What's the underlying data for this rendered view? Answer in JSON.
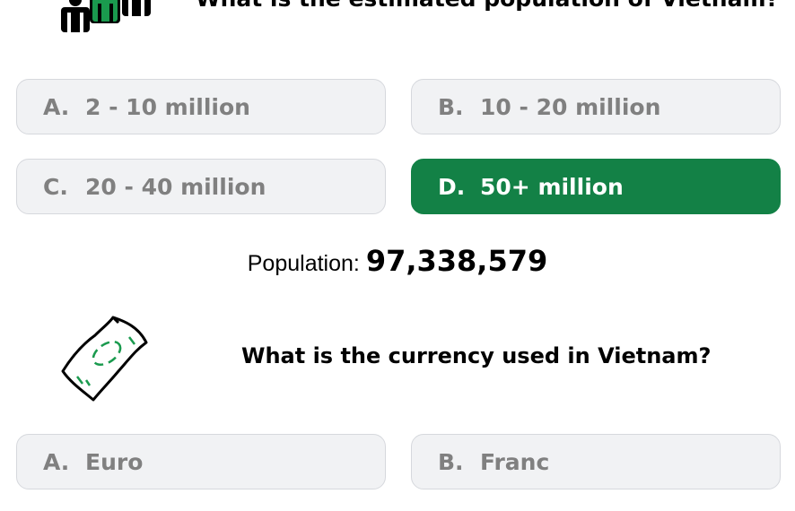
{
  "question1": {
    "icon": "people-group-icon",
    "text": "What is the estimated population of Vietnam?",
    "options": [
      {
        "letter": "A.",
        "label": "2 - 10 million",
        "selected": false
      },
      {
        "letter": "B.",
        "label": "10 - 20 million",
        "selected": false
      },
      {
        "letter": "C.",
        "label": "20 - 40 million",
        "selected": false
      },
      {
        "letter": "D.",
        "label": "50+ million",
        "selected": true
      }
    ],
    "result": {
      "label": "Population:",
      "value": "97,338,579"
    }
  },
  "question2": {
    "icon": "money-bill-icon",
    "text": "What is the currency used in Vietnam?",
    "options": [
      {
        "letter": "A.",
        "label": "Euro",
        "selected": false
      },
      {
        "letter": "B.",
        "label": "Franc",
        "selected": false
      }
    ]
  },
  "colors": {
    "selected_option": "#138146",
    "option_background": "#f1f2f4",
    "option_text": "#808080"
  }
}
